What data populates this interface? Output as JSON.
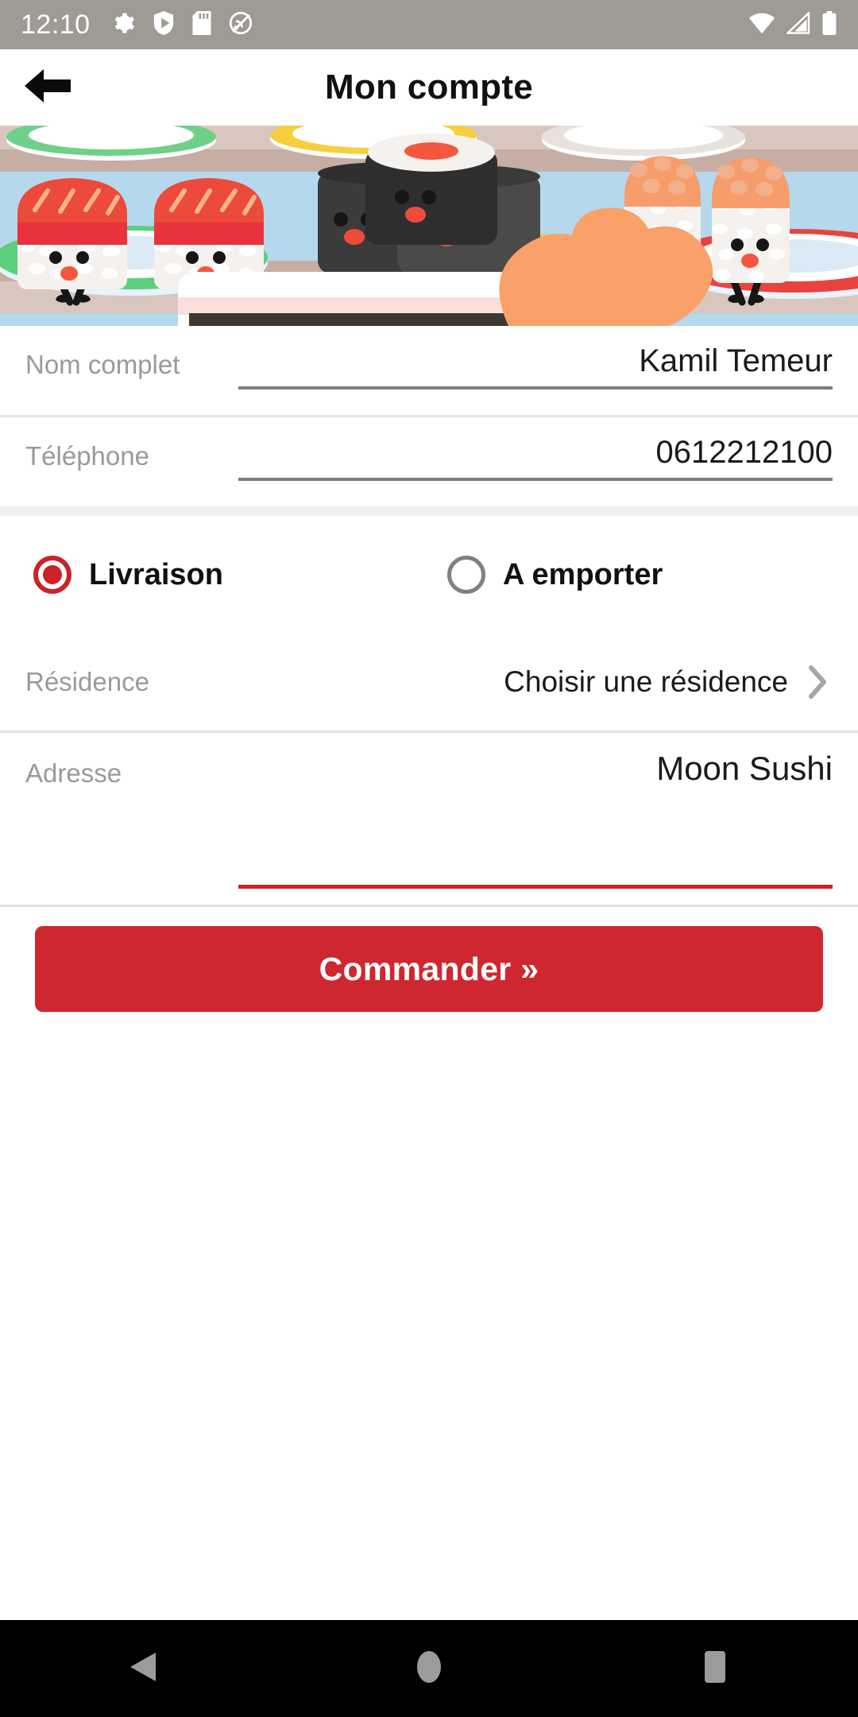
{
  "status_bar": {
    "clock": "12:10",
    "left_icons": [
      "gear-icon",
      "play-shield-icon",
      "sd-card-icon",
      "do-not-disturb-icon"
    ],
    "right_icons": [
      "wifi-icon",
      "cellular-signal-icon",
      "battery-icon"
    ],
    "background_color": "#9e9a94"
  },
  "header": {
    "title": "Mon compte",
    "back_icon": "arrow-left-icon"
  },
  "banner": {
    "alt": "cartoon sushi characters on conveyor belt plates",
    "sky_color": "#b5d8ec",
    "belt_color": "#c9b3ab"
  },
  "form": {
    "full_name": {
      "label": "Nom complet",
      "value": "Kamil Temeur",
      "placeholder": "Nom complet"
    },
    "phone": {
      "label": "Téléphone",
      "value": "0612212100",
      "placeholder": "Téléphone"
    },
    "order_mode": {
      "options": [
        {
          "label": "Livraison",
          "selected": true
        },
        {
          "label": "A emporter",
          "selected": false
        }
      ],
      "selected_color": "#cc2229"
    },
    "residence": {
      "label": "Résidence",
      "value": "Choisir une résidence",
      "chevron_icon": "chevron-right-icon"
    },
    "address": {
      "label": "Adresse",
      "value": "Moon Sushi",
      "placeholder": "Adresse",
      "focused": true,
      "focus_color": "#cc2229"
    }
  },
  "cta": {
    "label": "Commander »",
    "background_color": "#cf2730",
    "text_color": "#ffffff"
  },
  "nav_bar": {
    "background_color": "#000000",
    "buttons": [
      "back-triangle-icon",
      "home-circle-icon",
      "recents-square-icon"
    ]
  }
}
